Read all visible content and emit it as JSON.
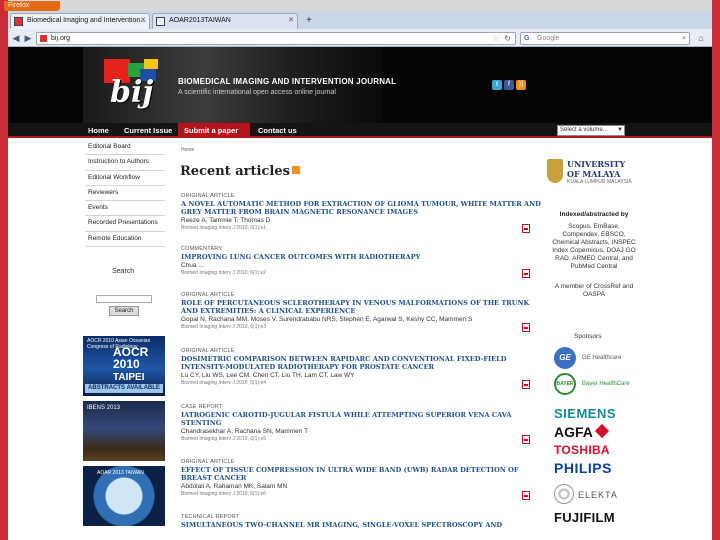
{
  "browser": {
    "app_button": "Firefox",
    "tabs": [
      {
        "label": "Biomedical Imaging and Intervention..."
      },
      {
        "label": "AOAR2013TAIWAN"
      }
    ],
    "url": "bij.org",
    "search_placeholder": "Google",
    "search_engine_glyph": "G"
  },
  "banner": {
    "logo_text": "bij",
    "title": "BIOMEDICAL IMAGING AND INTERVENTION JOURNAL",
    "subtitle": "A scientific international open access online journal",
    "social": [
      "t",
      "f",
      "rss"
    ]
  },
  "menu": {
    "items": [
      "Home",
      "Current Issue",
      "Submit a paper",
      "Contact us"
    ],
    "active": "Submit a paper",
    "volume_select": "Select a volume..."
  },
  "left_menu": {
    "items": [
      "Editorial Board",
      "Instruction to Authors",
      "Editorial Workflow",
      "Reviewers",
      "Events",
      "Recorded Presentations",
      "Remote Education"
    ]
  },
  "left_search": {
    "label": "Search",
    "input_value": "",
    "button": "Search"
  },
  "ads": {
    "ad1": {
      "small": "AOCR 2010 Asian Oceanian Congress of Radiology",
      "big1": "AOCR",
      "big2": "2010",
      "big3": "TAIPEI",
      "strip": "ABSTRACTS AVAILABLE"
    },
    "ad2": {
      "small": "IBENS 2013"
    },
    "ad3": {
      "small": "AOAR 2013 TAIWAN"
    }
  },
  "main": {
    "breadcrumb": "Home",
    "heading": "Recent articles",
    "articles": [
      {
        "type": "ORIGINAL ARTICLE",
        "title": "A NOVEL AUTOMATIC METHOD FOR EXTRACTION OF GLIOMA TUMOUR, WHITE MATTER AND GREY MATTER FROM BRAIN MAGNETIC RESONANCE IMAGES",
        "authors": "Reeze A, Tammie T, Thomas D",
        "journal": "Biomed Imaging Interv J 2010; 6(1):e1"
      },
      {
        "type": "COMMENTARY",
        "title": "IMPROVING LUNG CANCER OUTCOMES WITH RADIOTHERAPY",
        "authors": "Chua ...",
        "journal": "Biomed Imaging Interv J 2010; 6(1):e2"
      },
      {
        "type": "ORIGINAL ARTICLE",
        "title": "ROLE OF PERCUTANEOUS SCLEROTHERAPY IN VENOUS MALFORMATIONS OF THE TRUNK AND EXTREMITIES: A CLINICAL EXPERIENCE",
        "authors": "Gopal N, Rachana MM, Moses V, Surendrababu NRS, Stephen E, Agarwal S, Keshy CC, Mammen S",
        "journal": "Biomed Imaging Interv J 2010; 6(1):e3"
      },
      {
        "type": "ORIGINAL ARTICLE",
        "title": "DOSIMETRIC COMPARISON BETWEEN RAPIDARC AND CONVENTIONAL FIXED-FIELD INTENSITY-MODULATED RADIOTHERAPY FOR PROSTATE CANCER",
        "authors": "Lu CY, Liu WS, Lee CM, Chen CT, Liu TH, Lam CT, Law WY",
        "journal": "Biomed Imaging Interv J 2010; 6(1):e4"
      },
      {
        "type": "CASE REPORT",
        "title": "IATROGENIC CAROTID-JUGULAR FISTULA WHILE ATTEMPTING SUPERIOR VENA CAVA STENTING",
        "authors": "Chandrasekhar A, Rachana SN, Mammen T",
        "journal": "Biomed Imaging Interv J 2010; 6(1):e5"
      },
      {
        "type": "ORIGINAL ARTICLE",
        "title": "EFFECT OF TISSUE COMPRESSION IN ULTRA WIDE BAND (UWB) RADAR DETECTION OF BREAST CANCER",
        "authors": "Abdolali A, Rahaman MK, Salam MN",
        "journal": "Biomed Imaging Interv J 2010; 6(1):e6"
      },
      {
        "type": "TECHNICAL REPORT",
        "title": "SIMULTANEOUS TWO-CHANNEL MR IMAGING, SINGLE-VOXEL SPECTROSCOPY AND",
        "authors": "",
        "journal": ""
      }
    ]
  },
  "right": {
    "university": {
      "line1": "UNIVERSITY",
      "line2": "OF MALAYA",
      "line3": "KUALA LUMPUR MALAYSIA"
    },
    "indexed_title": "Indexed/abstracted by",
    "indexed_list": "Scopus, EmBase, Compendex, EBSCO, Chemical Abstracts, INSPEC Index Copernicus, DOAJ GO RAD, ARMED Central, and PubMed Central",
    "member": "A member of CrossRef and OASPA",
    "sponsors_label": "Sponsors",
    "sponsors": {
      "ge": "GE",
      "ge_text": "GE Healthcare",
      "bayer": "BAYER",
      "bayer_text": "Bayer HealthCare",
      "siemens": "SIEMENS",
      "agfa": "AGFA",
      "toshiba": "TOSHIBA",
      "philips": "PHILIPS",
      "elekta": "ELEKTA",
      "fujifilm": "FUJIFILM"
    }
  },
  "colors": {
    "brand_red": "#b5121b",
    "link_blue": "#1e4f8c",
    "menubar": "#141414"
  }
}
